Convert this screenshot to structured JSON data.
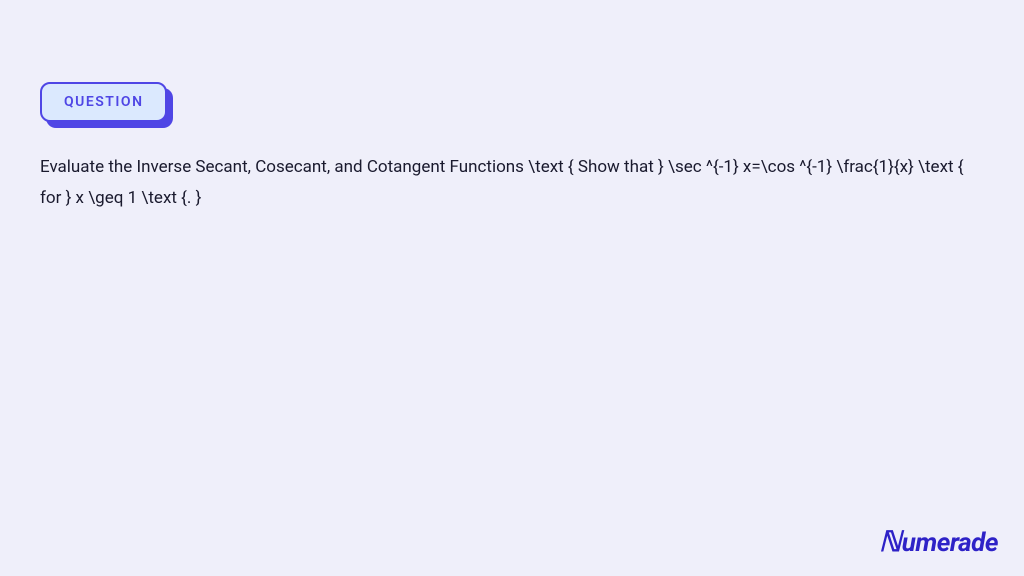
{
  "badge": {
    "label": "QUESTION"
  },
  "question": {
    "text": "Evaluate the Inverse Secant, Cosecant, and Cotangent Functions \\text { Show that } \\sec ^{-1} x=\\cos ^{-1} \\frac{1}{x} \\text { for } x \\geq 1 \\text {. }"
  },
  "brand": {
    "name": "Numerade"
  }
}
